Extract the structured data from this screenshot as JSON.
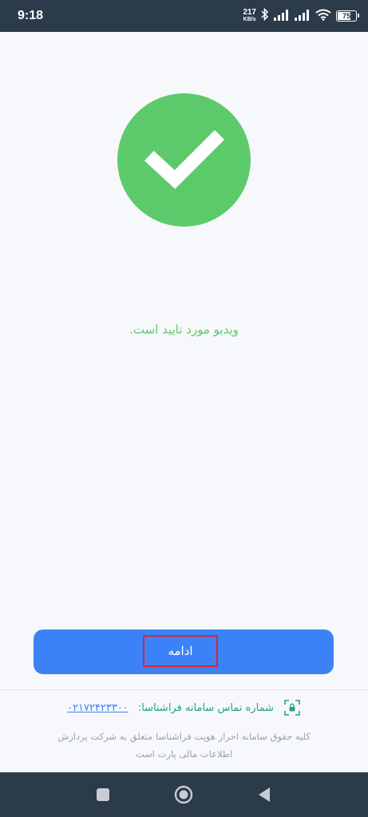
{
  "status_bar": {
    "time": "9:18",
    "net_speed_value": "217",
    "net_speed_unit": "KB/s",
    "battery_level": 75,
    "battery_label": "75",
    "icons": [
      "bluetooth-icon",
      "signal-icon",
      "signal-icon",
      "wifi-icon",
      "battery-icon"
    ]
  },
  "main": {
    "status_icon": "check-circle-icon",
    "success_message": "ویدیو مورد تایید است.",
    "accent_color": "#5cca6a"
  },
  "actions": {
    "continue_label": "ادامه",
    "button_color": "#3b82f6",
    "highlight_color": "#e0222c"
  },
  "footer": {
    "contact_label": "شماره تماس سامانه فراشناسا:",
    "contact_phone": "۰۲۱۷۲۴۲۳۳۰۰",
    "support_icon": "face-scan-icon",
    "copyright_line1": "کلیه حقوق سامانه احراز هویت فراشناسا متعلق به شرکت پردازش",
    "copyright_line2": "اطلاعات مالی پارت است"
  },
  "nav_bar": {
    "buttons": [
      "recents-square-icon",
      "home-circle-icon",
      "back-triangle-icon"
    ]
  }
}
